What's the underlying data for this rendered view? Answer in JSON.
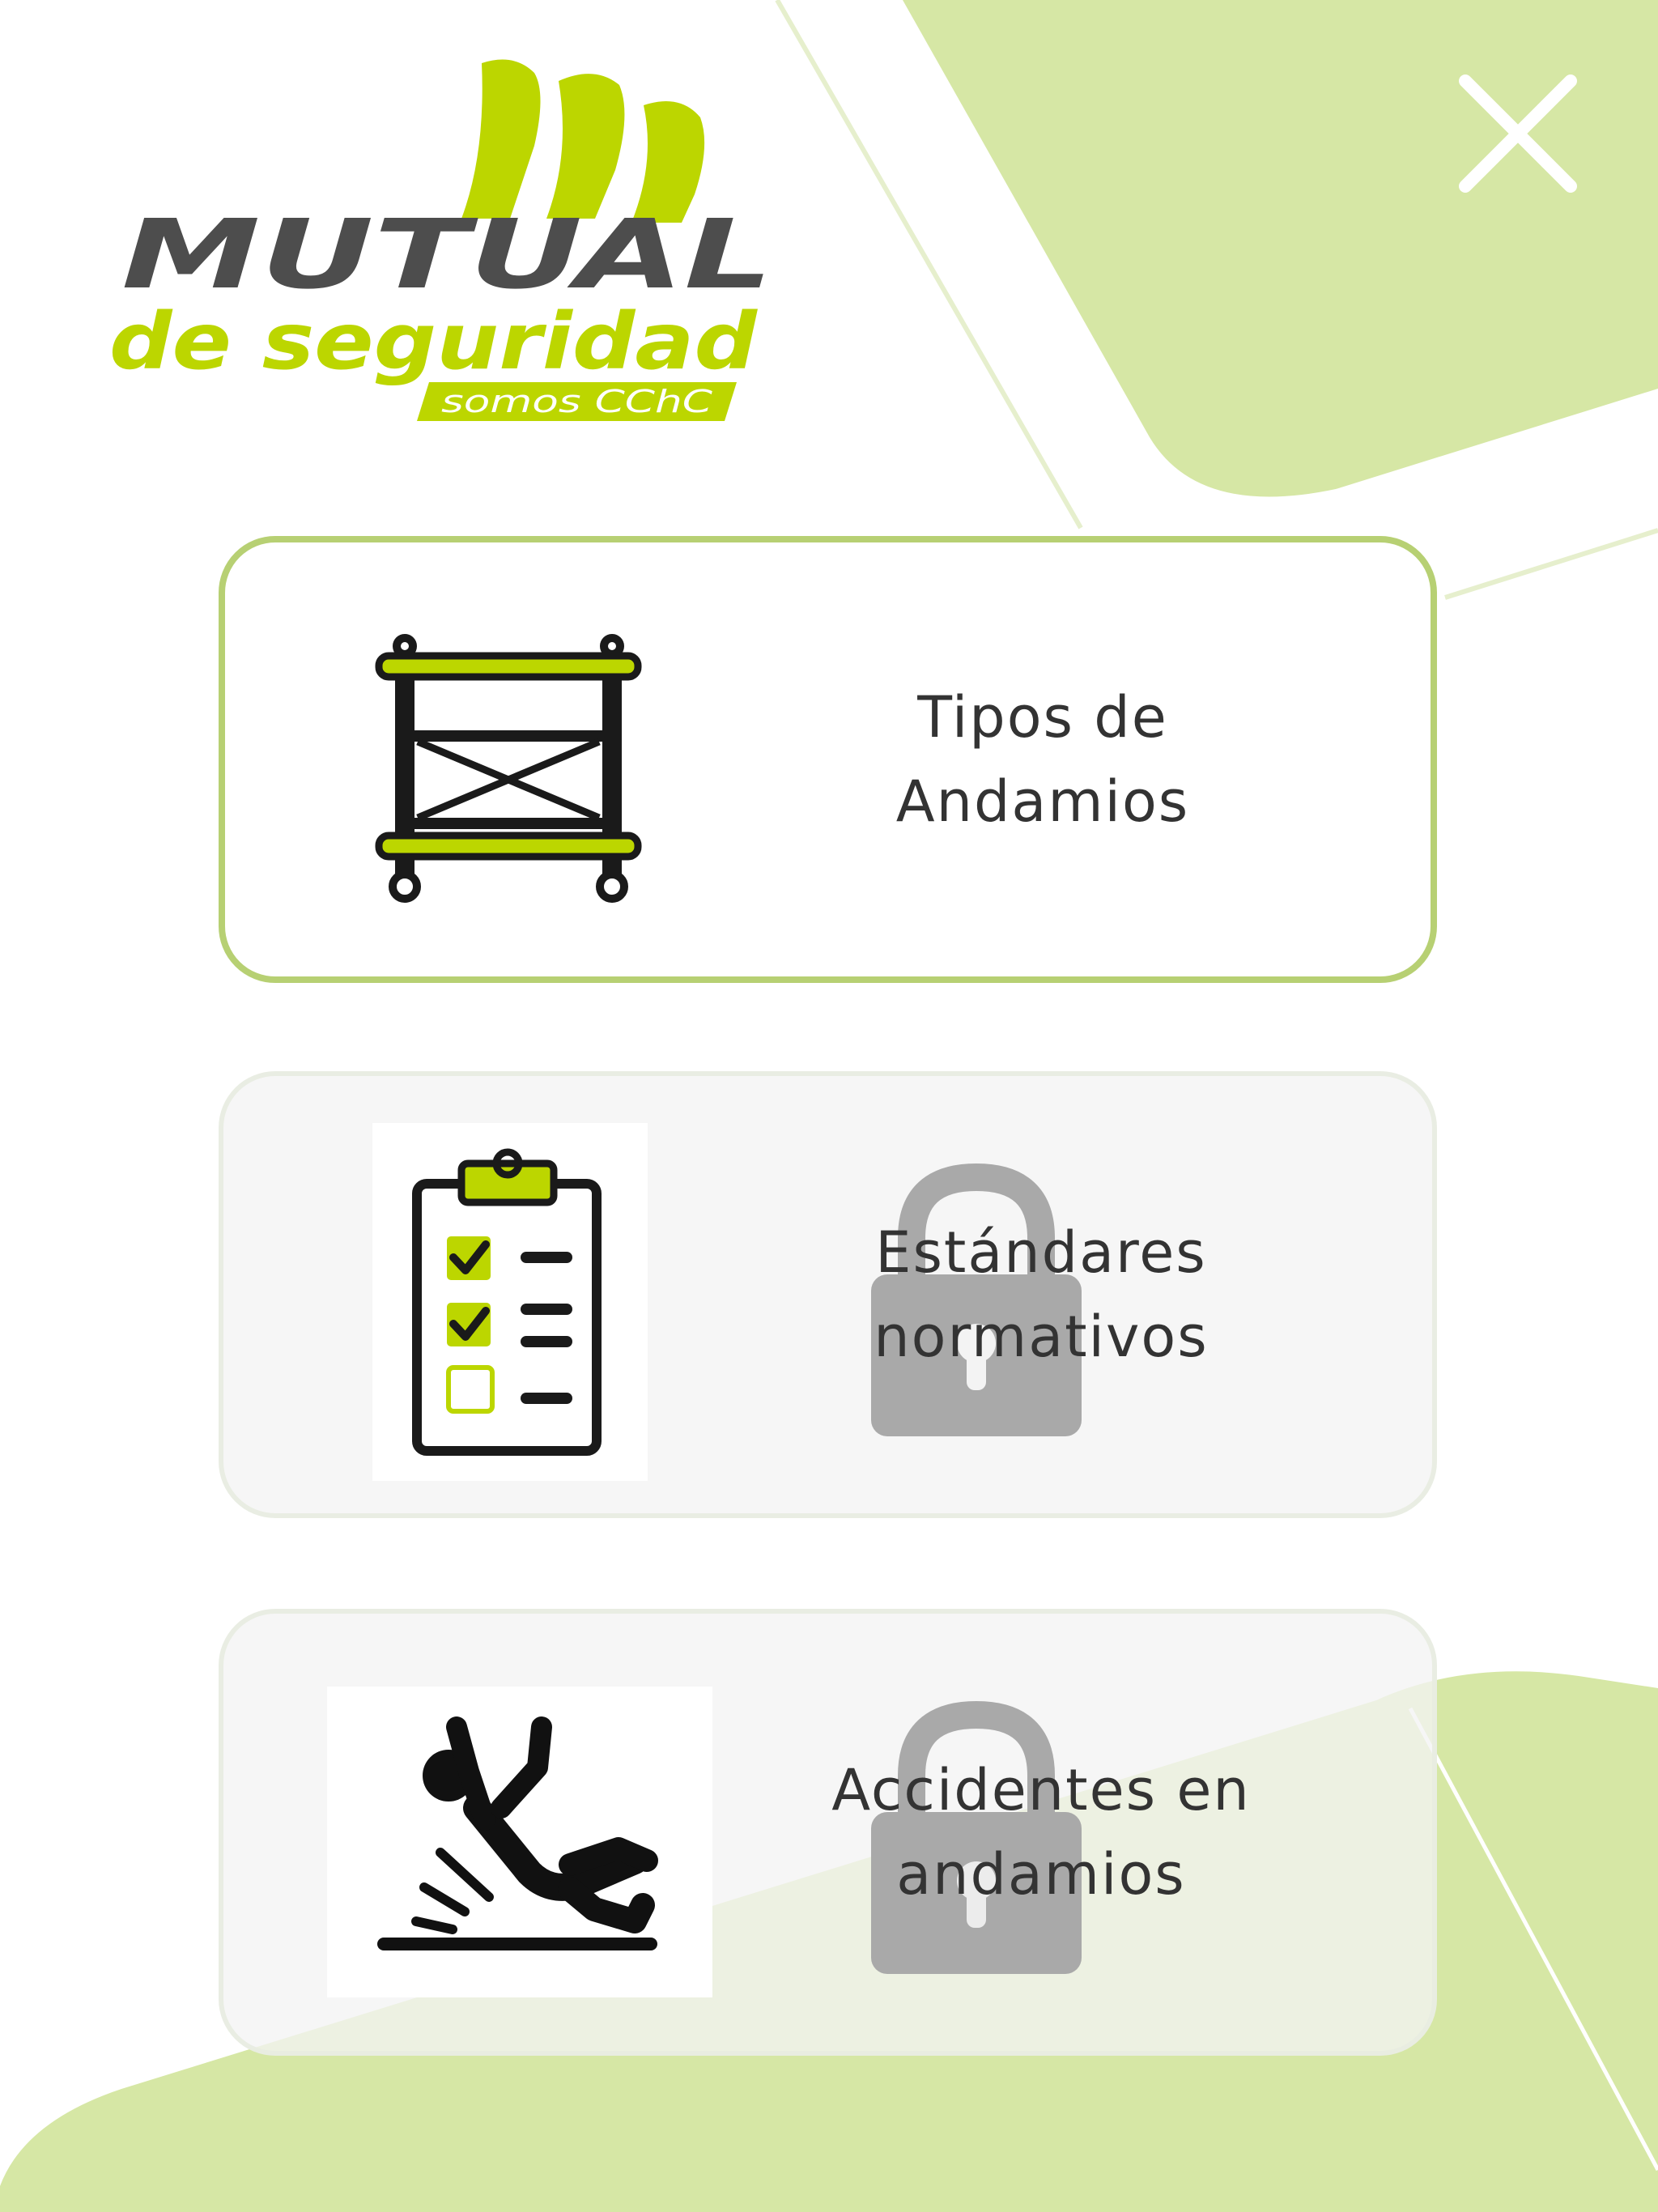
{
  "logo": {
    "brand": "MUTUAL",
    "subtitle": "de seguridad",
    "tagline": "somos CChC"
  },
  "colors": {
    "accent": "#bcd600",
    "light_green": "#d6e7a5",
    "card_border": "#b7d073",
    "lock": "#a9a9a9",
    "text": "#333333"
  },
  "header": {
    "close_icon": "close-icon"
  },
  "menu": {
    "items": [
      {
        "label": "Tipos de\nAndamios",
        "icon": "scaffold-icon",
        "locked": false
      },
      {
        "label": "Estándares\nnormativos",
        "icon": "checklist-clipboard-icon",
        "locked": true
      },
      {
        "label": "Accidentes en\nandamios",
        "icon": "falling-person-icon",
        "locked": true
      }
    ]
  }
}
